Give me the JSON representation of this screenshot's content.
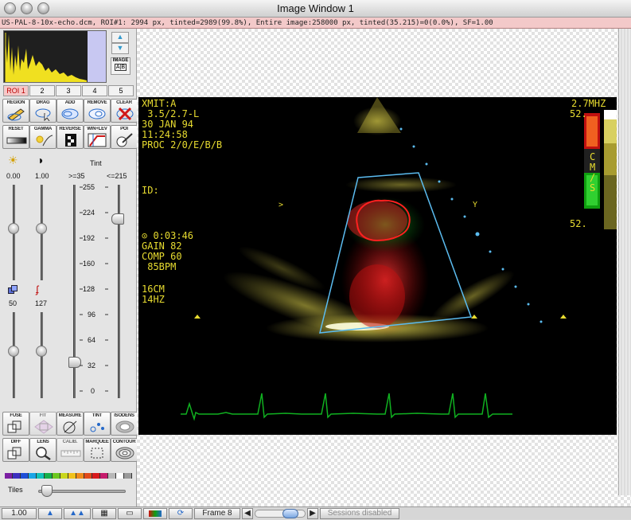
{
  "window": {
    "title": "Image Window 1"
  },
  "infobar": {
    "text": "US-PAL-8-10x-echo.dcm, ROI#1: 2994 px, tinted=2989(99.8%), Entire image:258000 px, tinted(35.215)=0(0.0%), SF=1.00"
  },
  "side": {
    "image_btn": "IMAGE",
    "image_ab": "A|B",
    "roi_tabs": [
      "ROI 1",
      "2",
      "3",
      "4",
      "5"
    ],
    "tools_row1": [
      "REGION",
      "DRAG",
      "ADD",
      "REMOVE",
      "CLEAR"
    ],
    "tools_row2": [
      "RESET",
      "GAMMA",
      "REVERSE",
      "WIN+LEV",
      "POI"
    ],
    "bright_val": "0.00",
    "contrast_val": "1.00",
    "tint_label": "Tint",
    "tint_low": ">=35",
    "tint_high": "<=215",
    "scale": [
      "255",
      "224",
      "192",
      "160",
      "128",
      "96",
      "64",
      "32",
      "0"
    ],
    "lower_left_val": "50",
    "lower_right_val": "127",
    "tools_row3": [
      "FUSE",
      "FIT",
      "MEASURE",
      "TINT",
      "ISODENS"
    ],
    "tools_row4": [
      "DIFF",
      "LENS",
      "CALIB.",
      "MARQUEE",
      "CONTOUR"
    ],
    "tiles_label": "Tiles",
    "palette": [
      "#7b1fa2",
      "#3d2fbf",
      "#1e4fd8",
      "#1aa5e6",
      "#12c3b7",
      "#16b04a",
      "#6cc81f",
      "#c9d61d",
      "#f1c11a",
      "#f08a1a",
      "#e14a1a",
      "#d8191c",
      "#c61c6c",
      "#b7b7b7",
      "#ffffff",
      "#9a9a9a"
    ]
  },
  "overlay": {
    "xmit": "XMIT:A",
    "probe": " 3.5/2.7-L",
    "date": "30 JAN 94",
    "time": "11:24:58",
    "proc": "PROC 2/0/E/B/B",
    "id": "ID:",
    "clock": "⊙ 0:03:46",
    "gain": "GAIN 82",
    "comp": "COMP 60",
    "bpm": " 85BPM",
    "depth": "16CM",
    "hz": "14HZ",
    "mhz": "2.7MHZ",
    "top_scale": "52.",
    "cms": "C\nM\n/\nS",
    "bottom_scale": "52."
  },
  "status": {
    "zoom": "1.00",
    "frame": "Frame 8",
    "sessions": "Sessions disabled"
  },
  "chart_data": {
    "type": "line",
    "title": "",
    "ecg_note": "ECG trace shown as green waveform with 5 R-peaks"
  }
}
